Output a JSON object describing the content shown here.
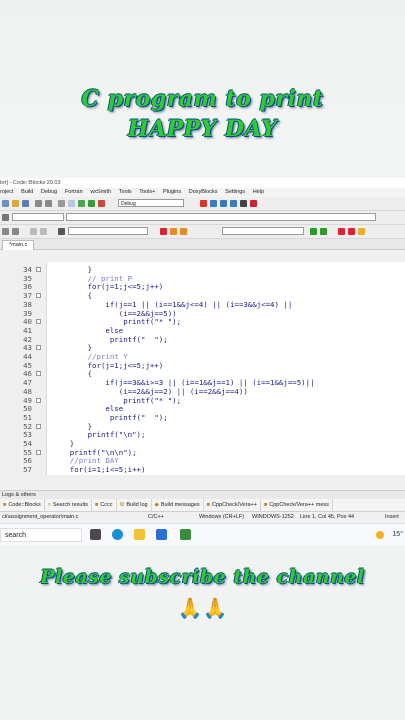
{
  "captions": {
    "line1": "C program to print",
    "line2": "HAPPY DAY",
    "line3": "Please subscribe the channel",
    "emoji": "🙏🙏"
  },
  "window": {
    "title": "tor] - Code::Blocks 20.03",
    "menu": [
      "roject",
      "Build",
      "Debug",
      "Fortran",
      "wxSmith",
      "Tools",
      "Tools+",
      "Plugins",
      "DoxyBlocks",
      "Settings",
      "Help"
    ],
    "build_target": "Debug",
    "tab": "*main.c"
  },
  "code": [
    {
      "num": "34",
      "text": "        }",
      "comment": false
    },
    {
      "num": "35",
      "text": "        // print P",
      "comment": true
    },
    {
      "num": "36",
      "text": "        for(j=1;j<=5;j++)",
      "comment": false
    },
    {
      "num": "37",
      "text": "        {",
      "comment": false
    },
    {
      "num": "38",
      "text": "            if(j==1 || (i==1&&j<=4) || (i==3&&j<=4) ||",
      "comment": false
    },
    {
      "num": "39",
      "text": "               (i==2&&j==5))",
      "comment": false
    },
    {
      "num": "40",
      "text": "                printf(\"* \");",
      "comment": false
    },
    {
      "num": "41",
      "text": "            else",
      "comment": false
    },
    {
      "num": "42",
      "text": "             printf(\"  \");",
      "comment": false
    },
    {
      "num": "43",
      "text": "        }",
      "comment": false
    },
    {
      "num": "44",
      "text": "        //print Y",
      "comment": true
    },
    {
      "num": "45",
      "text": "        for(j=1;j<=5;j++)",
      "comment": false
    },
    {
      "num": "46",
      "text": "        {",
      "comment": false
    },
    {
      "num": "47",
      "text": "            if(j==3&&i>=3 || (i==1&&j==1) || (i==1&&j==5)||",
      "comment": false
    },
    {
      "num": "48",
      "text": "               (i==2&&j==2) || (i==2&&j==4))",
      "comment": false
    },
    {
      "num": "49",
      "text": "                printf(\"* \");",
      "comment": false
    },
    {
      "num": "50",
      "text": "            else",
      "comment": false
    },
    {
      "num": "51",
      "text": "             printf(\"  \");",
      "comment": false
    },
    {
      "num": "52",
      "text": "        }",
      "comment": false
    },
    {
      "num": "53",
      "text": "        printf(\"\\n\");",
      "comment": false
    },
    {
      "num": "54",
      "text": "    }",
      "comment": false
    },
    {
      "num": "55",
      "text": "    printf(\"\\n\\n\");",
      "comment": false
    },
    {
      "num": "56",
      "text": "    //print DAY",
      "comment": true
    },
    {
      "num": "57",
      "text": "    for(i=1;i<=5;i++)",
      "comment": false
    }
  ],
  "log_panel": {
    "title": "Logs & others",
    "tabs": [
      "Code::Blocks",
      "Search results",
      "Cccc",
      "Build log",
      "Build messages",
      "CppCheck/Vera++",
      "CppCheck/Vera++ mess"
    ]
  },
  "status": {
    "path": "ck\\assignment_operator\\main.c",
    "language": "C/C++",
    "eol": "Windows (CR+LF)",
    "encoding": "WINDOWS-1252",
    "position": "Line 1, Col 45, Pos 44",
    "mode": "Insert"
  },
  "taskbar": {
    "search": "search",
    "weather": "15°"
  },
  "colors": {
    "caption_green": "#2ecc2e",
    "caption_outline": "#0e4a8a",
    "code_text": "#1a1a8a",
    "comment_text": "#7a7ad8"
  }
}
